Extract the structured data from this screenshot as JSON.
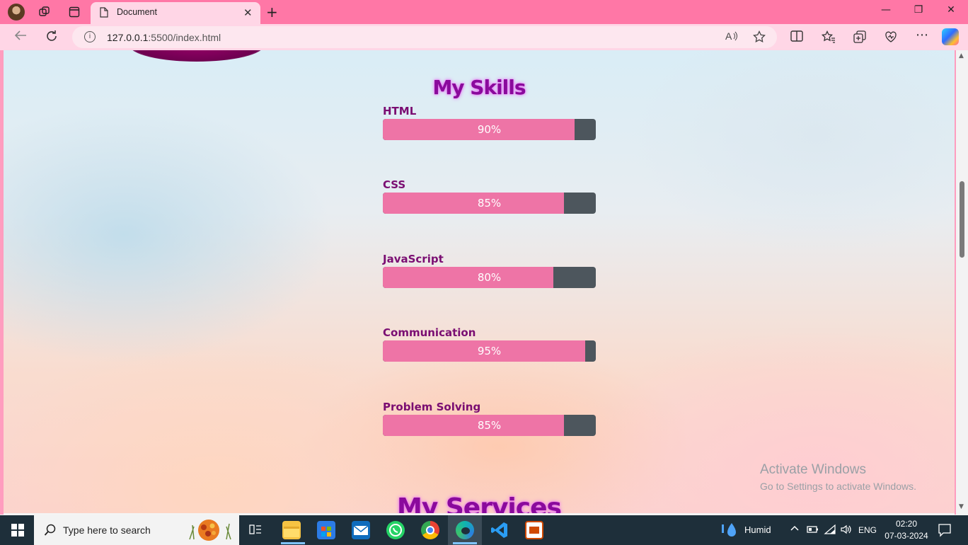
{
  "browser": {
    "tab_title": "Document",
    "tab_close": "✕",
    "new_tab": "+",
    "url_host": "127.0.0.1",
    "url_path": ":5500/index.html",
    "window_controls": {
      "minimize": "—",
      "restore": "❐",
      "close": "✕"
    }
  },
  "page": {
    "skills_title": "My Skills",
    "services_title": "My Services",
    "skills": [
      {
        "name": "HTML",
        "percent_label": "90%",
        "percent": 90
      },
      {
        "name": "CSS",
        "percent_label": "85%",
        "percent": 85
      },
      {
        "name": "JavaScript",
        "percent_label": "80%",
        "percent": 80
      },
      {
        "name": "Communication",
        "percent_label": "95%",
        "percent": 95
      },
      {
        "name": "Problem Solving",
        "percent_label": "85%",
        "percent": 85
      }
    ],
    "watermark": {
      "line1": "Activate Windows",
      "line2": "Go to Settings to activate Windows."
    }
  },
  "taskbar": {
    "search_placeholder": "Type here to search",
    "weather": "Humid",
    "language": "ENG",
    "time": "02:20",
    "date": "07-03-2024"
  },
  "colors": {
    "tabbar": "#ff77a6",
    "addrbar": "#ffd6e6",
    "bar_fill": "#ee74a6",
    "bar_track": "#4d565d",
    "skill_name": "#7a0d72",
    "title": "#8a0a9c"
  }
}
